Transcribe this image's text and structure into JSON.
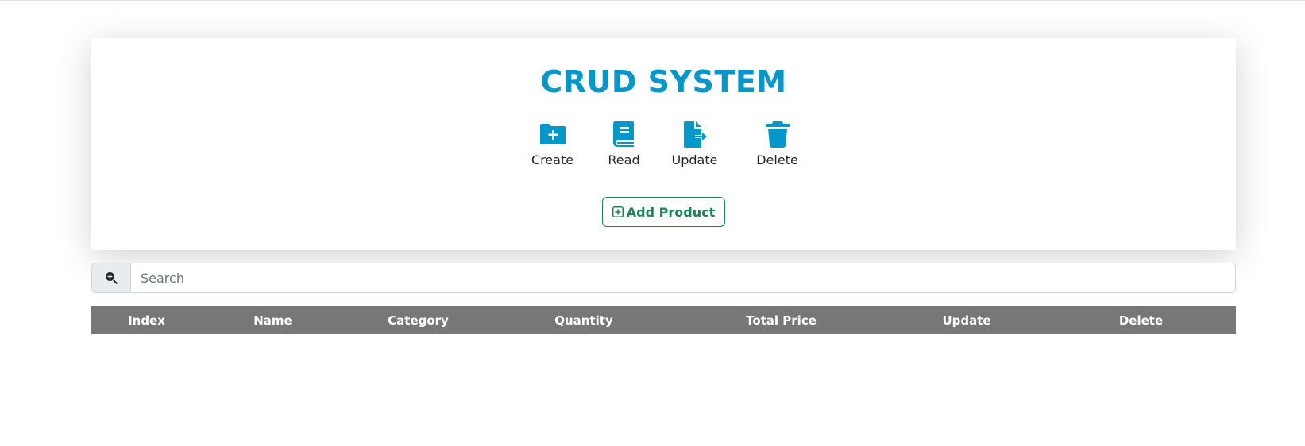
{
  "colors": {
    "accent": "#0597c9",
    "success": "#198754",
    "table_header": "#777777"
  },
  "header": {
    "title": "CRUD SYSTEM"
  },
  "operations": [
    {
      "label": "Create",
      "icon": "folder-plus-icon"
    },
    {
      "label": "Read",
      "icon": "book-icon"
    },
    {
      "label": "Update",
      "icon": "file-export-icon"
    },
    {
      "label": "Delete",
      "icon": "trash-icon"
    }
  ],
  "add_button": {
    "label": "Add Product",
    "icon": "square-plus-icon"
  },
  "search": {
    "placeholder": "Search",
    "value": "",
    "icon": "magnifier-plus-icon"
  },
  "table": {
    "columns": [
      "Index",
      "Name",
      "Category",
      "Quantity",
      "Total Price",
      "Update",
      "Delete"
    ],
    "rows": []
  }
}
